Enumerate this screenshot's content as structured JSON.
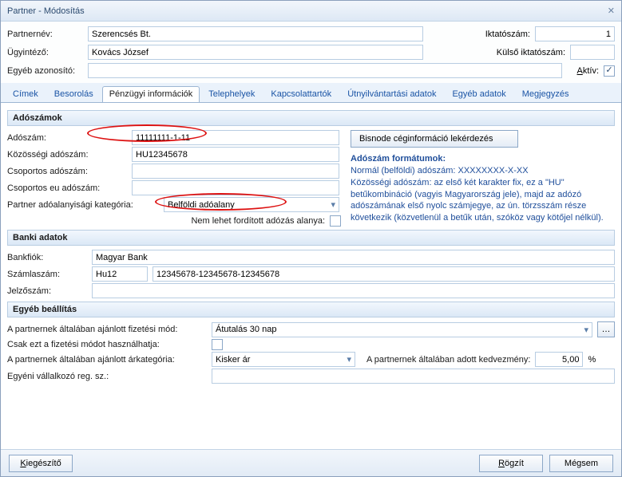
{
  "window": {
    "title": "Partner - Módosítás"
  },
  "header": {
    "partner_nev_label": "Partnernév:",
    "partner_nev": "Szerencsés Bt.",
    "iktatoszam_label": "Iktatószám:",
    "iktatoszam": "1",
    "ugyintezo_label": "Ügyintéző:",
    "ugyintezo": "Kovács József",
    "kulso_iktatoszam_label": "Külső iktatószám:",
    "kulso_iktatoszam": "",
    "egyeb_azonosito_label": "Egyéb azonosító:",
    "egyeb_azonosito": "",
    "aktiv_label": "Aktív:"
  },
  "tabs": {
    "cimek": "Címek",
    "besorolas": "Besorolás",
    "penzugyi": "Pénzügyi információk",
    "telephelyek": "Telephelyek",
    "kapcsolattartok": "Kapcsolattartók",
    "utnyilvantartasi": "Útnyilvántartási adatok",
    "egyeb_adatok": "Egyéb adatok",
    "megjegyzes": "Megjegyzés"
  },
  "adoszamok": {
    "section": "Adószámok",
    "adoszam_label": "Adószám:",
    "adoszam": "11111111-1-11",
    "kozossegi_label": "Közösségi adószám:",
    "kozossegi": "HU12345678",
    "csoportos_label": "Csoportos adószám:",
    "csoportos": "",
    "csoportos_eu_label": "Csoportos eu adószám:",
    "csoportos_eu": "",
    "kategoria_label": "Partner adóalanyisági kategória:",
    "kategoria": "Belföldi adóalany",
    "nem_lehet_label": "Nem lehet fordított adózás alanya:",
    "bisnode_btn": "Bisnode céginformáció lekérdezés",
    "info_heading": "Adószám formátumok:",
    "info_l1": "Normál (belföldi) adószám: XXXXXXXX-X-XX",
    "info_l2": "Közösségi adószám: az első két karakter fix, ez a \"HU\" betűkombináció (vagyis Magyarország jele), majd az adózó adószámának első nyolc számjegye, az ún. törzsszám része következik (közvetlenül a betűk után, szóköz vagy kötőjel nélkül)."
  },
  "bank": {
    "section": "Banki adatok",
    "bankfiok_label": "Bankfiók:",
    "bankfiok": "Magyar Bank",
    "szamlaszam_label": "Számlaszám:",
    "szamlaszam_prefix": "Hu12",
    "szamlaszam": "12345678-12345678-12345678",
    "jelzoszam_label": "Jelzőszám:",
    "jelzoszam": ""
  },
  "egyeb": {
    "section": "Egyéb beállítás",
    "fizmod_label": "A partnernek általában ajánlott fizetési mód:",
    "fizmod": "Átutalás 30 nap",
    "csak_ezt_label": "Csak ezt a fizetési módot használhatja:",
    "arkategoria_label": "A partnernek általában ajánlott árkategória:",
    "arkategoria": "Kisker ár",
    "kedvezmeny_label": "A partnernek általában adott kedvezmény:",
    "kedvezmeny": "5,00",
    "kedvezmeny_unit": "%",
    "egyeni_label": "Egyéni vállalkozó reg. sz.:",
    "egyeni": ""
  },
  "footer": {
    "kiegeszito": "Kiegészítő",
    "rogzit": "Rögzít",
    "megsem": "Mégsem"
  }
}
